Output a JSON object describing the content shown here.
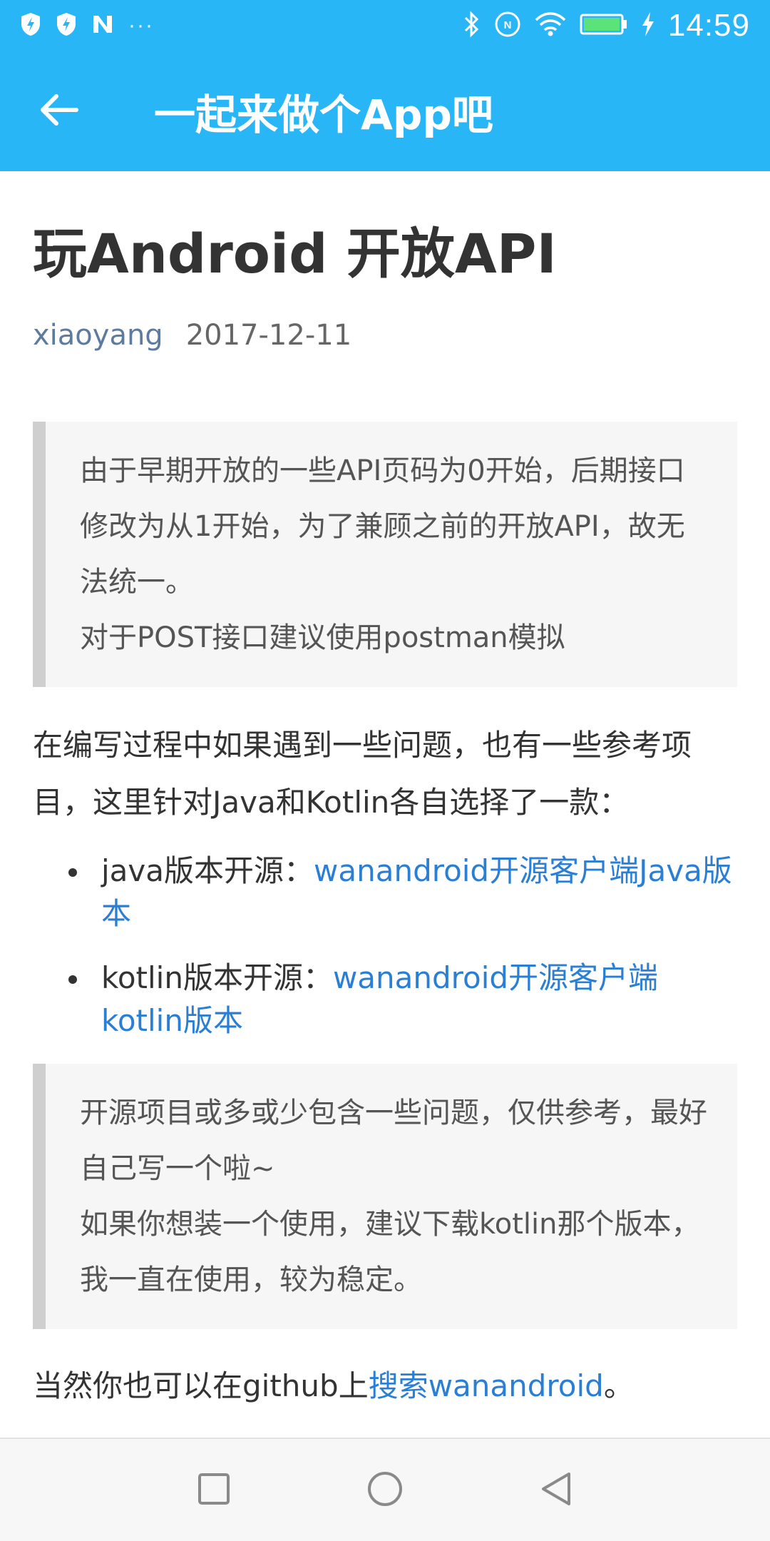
{
  "status_bar": {
    "time": "14:59",
    "more_indicator": "···",
    "left_icons": [
      "shield-bolt-icon",
      "shield-bolt-icon",
      "n-icon"
    ],
    "right_icons": [
      "bluetooth-icon",
      "nfc-icon",
      "wifi-icon",
      "battery-icon",
      "charging-icon"
    ]
  },
  "app_bar": {
    "title": "一起来做个App吧",
    "back_icon": "arrow-back-icon",
    "color": "#29b6f6"
  },
  "article": {
    "title": "玩Android 开放API",
    "author": "xiaoyang",
    "date": "2017-12-11",
    "quote1": {
      "line1": "由于早期开放的一些API页码为0开始，后期接口修改为从1开始，为了兼顾之前的开放API，故无法统一。",
      "line2": "对于POST接口建议使用postman模拟"
    },
    "intro": "在编写过程中如果遇到一些问题，也有一些参考项目，这里针对Java和Kotlin各自选择了一款：",
    "bullets": [
      {
        "prefix": "java版本开源：",
        "link": "wanandroid开源客户端Java版本"
      },
      {
        "prefix": "kotlin版本开源：",
        "link": "wanandroid开源客户端kotlin版本"
      }
    ],
    "quote2": {
      "line1": "开源项目或多或少包含一些问题，仅供参考，最好自己写一个啦~",
      "line2": "如果你想装一个使用，建议下载kotlin那个版本，我一直在使用，较为稳定。"
    },
    "outro": {
      "prefix": "当然你也可以在github上",
      "link": "搜索wanandroid",
      "suffix": "。"
    },
    "link_color": "#2a7fd4"
  },
  "nav_bar": {
    "icons": [
      "recents-square-icon",
      "home-circle-icon",
      "back-triangle-icon"
    ]
  }
}
